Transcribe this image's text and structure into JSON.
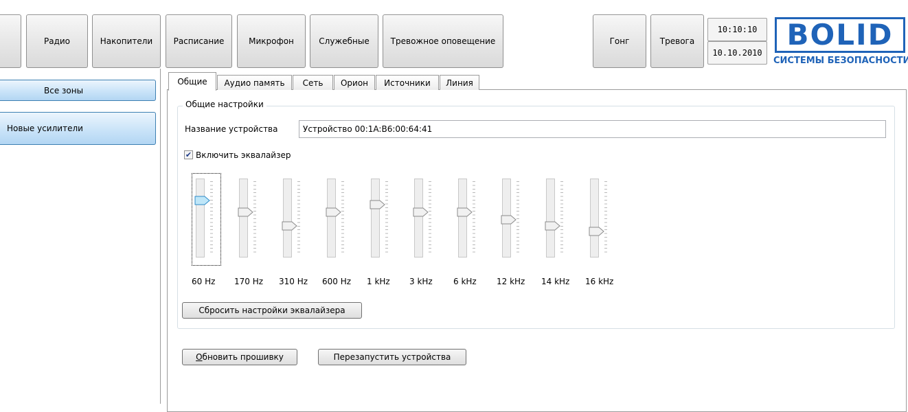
{
  "toolbar": {
    "tabs": [
      "Радио",
      "Накопители",
      "Расписание",
      "Микрофон",
      "Служебные",
      "Тревожное оповещение"
    ],
    "gong": "Гонг",
    "alarm": "Тревога"
  },
  "clock": {
    "time": "10:10:10",
    "date": "10.10.2010"
  },
  "brand": {
    "name": "BOLID",
    "tagline": "СИСТЕМЫ БЕЗОПАСНОСТИ",
    "color": "#1f63b8"
  },
  "zones": {
    "all": "Все зоны",
    "new_amps": "Новые усилители"
  },
  "tabs": [
    "Общие",
    "Аудио память",
    "Сеть",
    "Орион",
    "Источники",
    "Линия"
  ],
  "general": {
    "group_title": "Общие настройки",
    "device_name_label": "Название устройства",
    "device_name_value": "Устройство 00:1A:B6:00:64:41",
    "eq_checkbox_label": "Включить эквалайзер",
    "eq_enabled": true
  },
  "equalizer": {
    "bands": [
      {
        "label": "60 Hz",
        "level": 0.72
      },
      {
        "label": "170 Hz",
        "level": 0.57
      },
      {
        "label": "310 Hz",
        "level": 0.4
      },
      {
        "label": "600 Hz",
        "level": 0.57
      },
      {
        "label": "1 kHz",
        "level": 0.67
      },
      {
        "label": "3 kHz",
        "level": 0.57
      },
      {
        "label": "6 kHz",
        "level": 0.57
      },
      {
        "label": "12 kHz",
        "level": 0.48
      },
      {
        "label": "14 kHz",
        "level": 0.4
      },
      {
        "label": "16 kHz",
        "level": 0.33
      }
    ],
    "reset_button": "Сбросить настройки эквалайзера"
  },
  "actions": {
    "update_firmware": "Обновить прошивку",
    "restart_devices": "Перезапустить устройства"
  }
}
